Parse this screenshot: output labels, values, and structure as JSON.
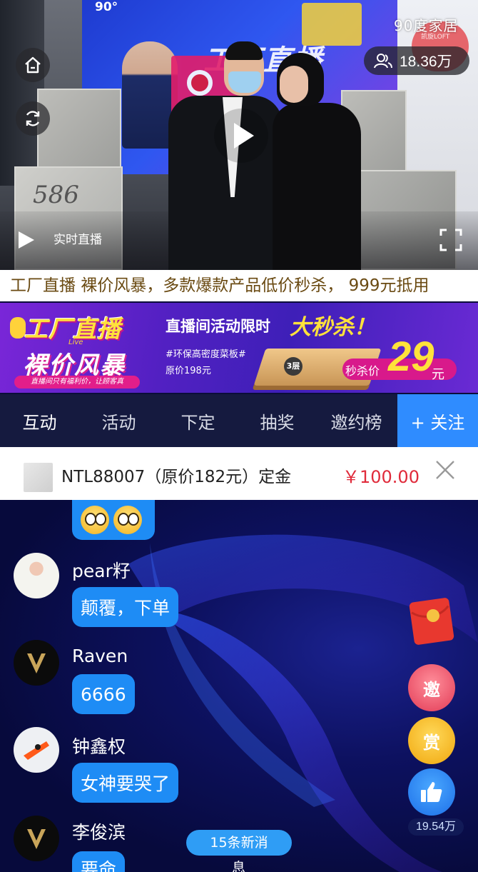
{
  "video": {
    "brand": "90度家居",
    "brand_sub": "凯旋LOFT",
    "viewer_count": "18.36万",
    "mode_label": "实时直播",
    "wall_scrawl": "586",
    "stage_text": "工厂直播"
  },
  "marquee": {
    "text": "工厂直播 裸价风暴，多款爆款产品低价秒杀， 999元抵用"
  },
  "banner": {
    "title_top": "工厂直播",
    "title_live": "Live",
    "title_bottom": "裸价风暴",
    "pill": "直播间只有福利价，让顾客真",
    "headline": "直播间活动限时",
    "sale": "大秒杀！",
    "tag": "#环保高密度菜板#",
    "original_price": "原价198元",
    "layers": "3层",
    "seckill_label": "秒杀价",
    "price": "29",
    "unit": "元"
  },
  "tabs": [
    {
      "label": "互动",
      "active": true
    },
    {
      "label": "活动",
      "active": false
    },
    {
      "label": "下定",
      "active": false
    },
    {
      "label": "抽奖",
      "active": false
    },
    {
      "label": "邀约榜",
      "active": false
    }
  ],
  "follow_label": "+ 关注",
  "product": {
    "name": "NTL88007（原价182元）定金",
    "price": "￥100.00"
  },
  "chat": {
    "messages": [
      {
        "user": "pear籽",
        "text": "颠覆，下单"
      },
      {
        "user": "Raven",
        "text": "6666"
      },
      {
        "user": "钟鑫权",
        "text": "女神要哭了"
      },
      {
        "user": "李俊滨",
        "text": "要命"
      }
    ]
  },
  "side": {
    "invite": "邀",
    "reward": "赏",
    "like_count": "19.54万"
  },
  "new_messages": {
    "line1": "15条新消",
    "line2": "息"
  },
  "colors": {
    "accent": "#2f8cff",
    "price_red": "#e02a3a",
    "tab_bg": "#151a3f",
    "bubble": "#1e8cf5"
  }
}
